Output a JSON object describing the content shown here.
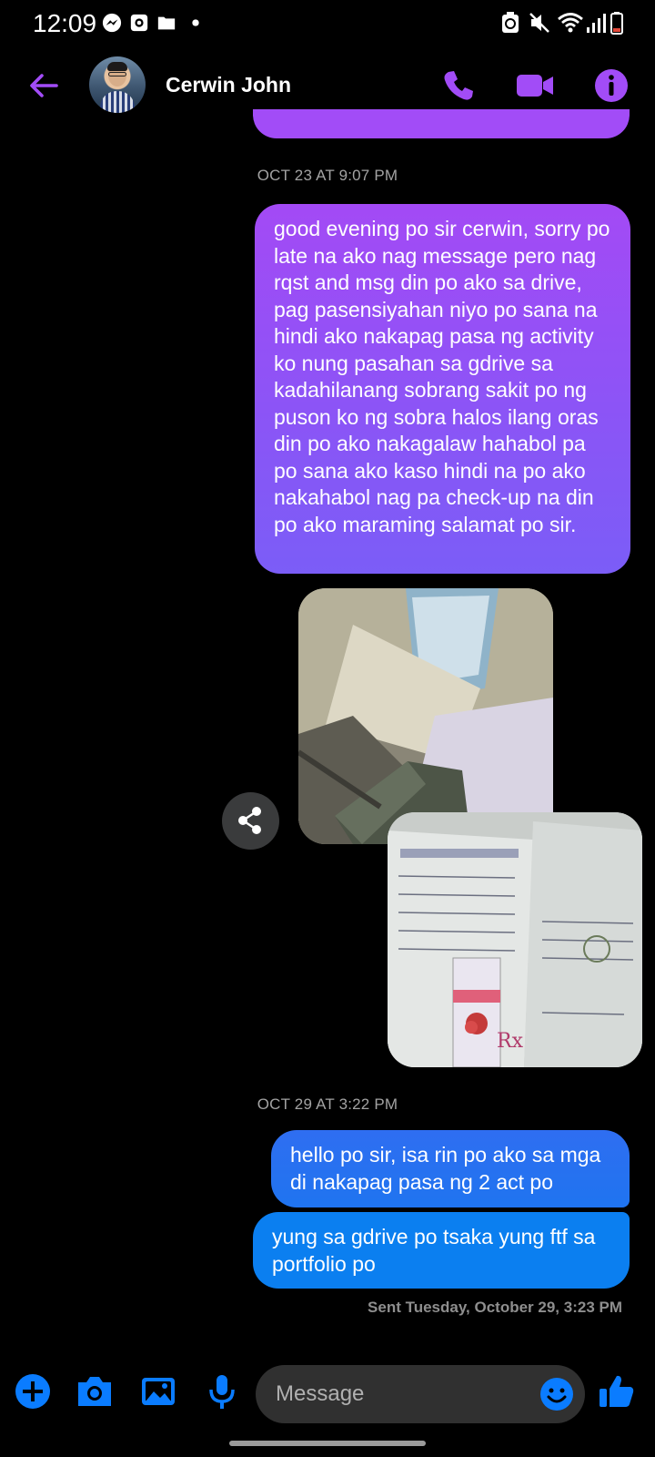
{
  "status_bar": {
    "time": "12:09",
    "icons": [
      "messenger-icon",
      "screenshot-icon",
      "folder-icon",
      "dot-icon"
    ],
    "right_icons": [
      "battery-saver-icon",
      "mute-icon",
      "wifi-icon",
      "signal-icon",
      "battery-low-icon"
    ]
  },
  "header": {
    "contact_name": "Cerwin John",
    "accent_color": "#a24cf7",
    "icons": [
      "back-arrow-icon",
      "phone-icon",
      "video-call-icon",
      "info-icon"
    ]
  },
  "messages": [
    {
      "type": "timestamp",
      "text": "OCT 23 AT 9:07 PM"
    },
    {
      "type": "text",
      "sender": "me",
      "color": "#a34af5",
      "text": "good evening po sir cerwin, sorry po late na ako nag message pero nag rqst and msg din po ako sa drive, pag pasensiyahan niyo po sana na hindi ako nakapag pasa ng activity ko nung pasahan sa gdrive sa kadahilanang sobrang sakit po ng puson ko ng sobra halos ilang oras din po ako nakagalaw hahabol pa po sana ako kaso hindi na po ako nakahabol nag pa check-up na din po ako maraming salamat po sir."
    },
    {
      "type": "photo",
      "sender": "me",
      "description_icon": "photo-hospital-bed-icon"
    },
    {
      "type": "photo",
      "sender": "me",
      "description_icon": "photo-medical-certificate-icon"
    },
    {
      "type": "timestamp",
      "text": "OCT 29 AT 3:22 PM"
    },
    {
      "type": "text",
      "sender": "me",
      "color": "#1f74f0",
      "text": "hello po sir, isa rin po ako sa mga di nakapag pasa ng 2 act po"
    },
    {
      "type": "text",
      "sender": "me",
      "color": "#0b7ff0",
      "text": "yung sa gdrive po tsaka yung ftf sa portfolio po"
    }
  ],
  "sent_status": "Sent Tuesday, October 29, 3:23 PM",
  "composer": {
    "placeholder": "Message",
    "icons": [
      "plus-icon",
      "camera-icon",
      "gallery-icon",
      "microphone-icon",
      "emoji-icon",
      "thumbs-up-icon"
    ],
    "icon_color": "#0a7cff"
  }
}
